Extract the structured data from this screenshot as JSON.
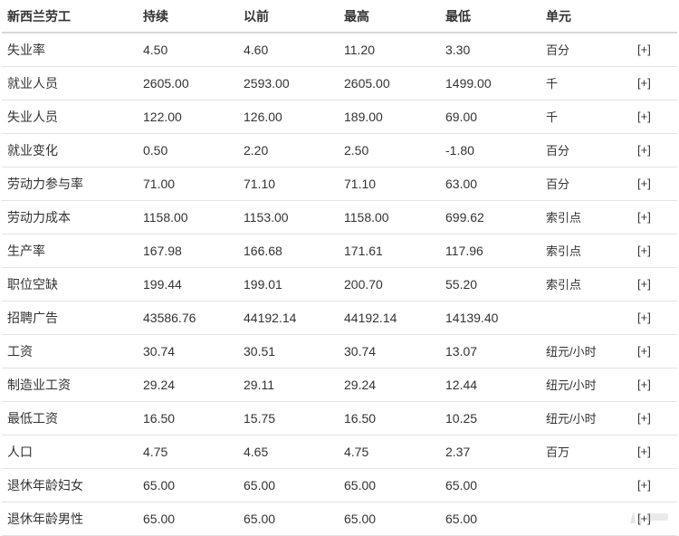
{
  "table": {
    "headers": [
      "新西兰劳工",
      "持续",
      "以前",
      "最高",
      "最低",
      "单元"
    ],
    "expand_label": "[+]",
    "rows": [
      [
        "失业率",
        "4.50",
        "4.60",
        "11.20",
        "3.30",
        "百分"
      ],
      [
        "就业人员",
        "2605.00",
        "2593.00",
        "2605.00",
        "1499.00",
        "千"
      ],
      [
        "失业人员",
        "122.00",
        "126.00",
        "189.00",
        "69.00",
        "千"
      ],
      [
        "就业变化",
        "0.50",
        "2.20",
        "2.50",
        "-1.80",
        "百分"
      ],
      [
        "劳动力参与率",
        "71.00",
        "71.10",
        "71.10",
        "63.00",
        "百分"
      ],
      [
        "劳动力成本",
        "1158.00",
        "1153.00",
        "1158.00",
        "699.62",
        "索引点"
      ],
      [
        "生产率",
        "167.98",
        "166.68",
        "171.61",
        "117.96",
        "索引点"
      ],
      [
        "职位空缺",
        "199.44",
        "199.01",
        "200.70",
        "55.20",
        "索引点"
      ],
      [
        "招聘广告",
        "43586.76",
        "44192.14",
        "44192.14",
        "14139.40",
        ""
      ],
      [
        "工资",
        "30.74",
        "30.51",
        "30.74",
        "13.07",
        "纽元/小时"
      ],
      [
        "制造业工资",
        "29.24",
        "29.11",
        "29.24",
        "12.44",
        "纽元/小时"
      ],
      [
        "最低工资",
        "16.50",
        "15.75",
        "16.50",
        "10.25",
        "纽元/小时"
      ],
      [
        "人口",
        "4.75",
        "4.65",
        "4.75",
        "2.37",
        "百万"
      ],
      [
        "退休年龄妇女",
        "65.00",
        "65.00",
        "65.00",
        "65.00",
        ""
      ],
      [
        "退休年龄男性",
        "65.00",
        "65.00",
        "65.00",
        "65.00",
        ""
      ]
    ]
  },
  "watermark": {
    "icon": "logo-watermark-icon"
  }
}
